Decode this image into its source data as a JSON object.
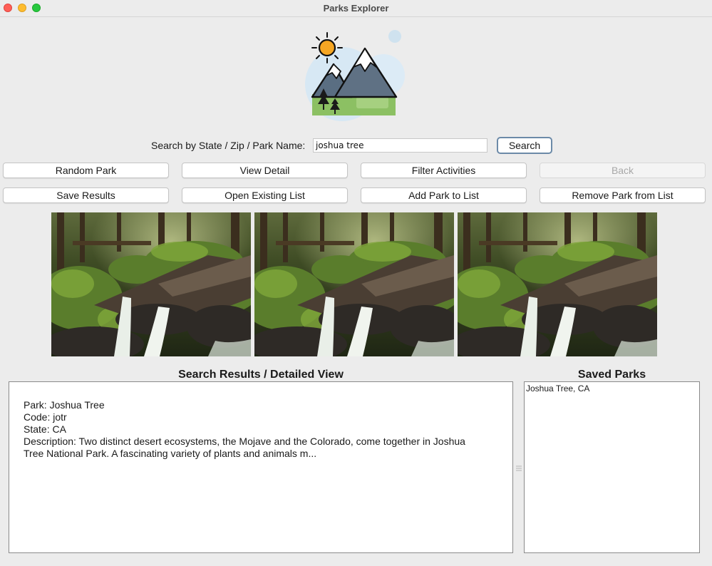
{
  "window": {
    "title": "Parks Explorer"
  },
  "search": {
    "label": "Search by State / Zip / Park Name:",
    "value": "joshua tree",
    "button_label": "Search"
  },
  "buttons": {
    "random_park": "Random Park",
    "view_detail": "View Detail",
    "filter_activities": "Filter Activities",
    "back": "Back",
    "save_results": "Save Results",
    "open_existing_list": "Open Existing List",
    "add_park_to_list": "Add Park to List",
    "remove_park_from_list": "Remove Park from List"
  },
  "results": {
    "heading": "Search Results / Detailed View",
    "park_line": "Park: Joshua Tree",
    "code_line": "Code: jotr",
    "state_line": "State: CA",
    "description_line": "Description: Two distinct desert ecosystems, the Mojave and the Colorado, come together in Joshua Tree National Park. A fascinating variety of plants and animals m..."
  },
  "saved": {
    "heading": "Saved Parks",
    "items": [
      "Joshua Tree, CA"
    ]
  },
  "icons": {
    "logo": "mountain-sun-logo",
    "photo": "forest-waterfall-photo"
  },
  "colors": {
    "accent_border": "#6c8aa8",
    "close": "#ff5f57",
    "minimize": "#febc2e",
    "maximize": "#28c840"
  }
}
